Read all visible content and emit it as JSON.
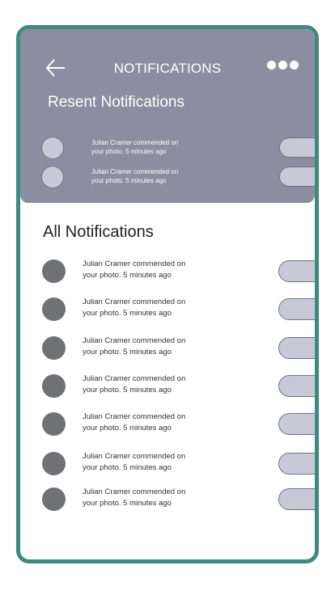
{
  "header": {
    "title": "NOTIFICATIONS",
    "back_icon": "arrow-left-icon",
    "more_icon": "more-horizontal-icon"
  },
  "recent": {
    "heading": "Resent Notifications",
    "items": [
      {
        "line1": "Julian Cramer commended on",
        "line2": "your photo. 5 minutes ago"
      },
      {
        "line1": "Julian Cramer commended on",
        "line2": "your photo. 5 minutes ago"
      }
    ]
  },
  "all": {
    "heading": "All Notifications",
    "items": [
      {
        "line1": "Julian Cramer commended on",
        "line2": "your photo. 5 minutes ago"
      },
      {
        "line1": "Julian Cramer commended on",
        "line2": "your photo. 5 minutes ago"
      },
      {
        "line1": "Julian Cramer commended on",
        "line2": "your photo. 5 minutes ago"
      },
      {
        "line1": "Julian Cramer commended on",
        "line2": "your photo. 5 minutes ago"
      },
      {
        "line1": "Julian Cramer commended on",
        "line2": "your photo. 5 minutes ago"
      },
      {
        "line1": "Julian Cramer commended on",
        "line2": "your photo. 5 minutes ago"
      },
      {
        "line1": "Julian Cramer commended on",
        "line2": "your photo. 5 minutes ago"
      }
    ]
  },
  "colors": {
    "frame": "#3f8a80",
    "header_bg": "#8b8ea0",
    "pill": "#c7cad6",
    "avatar": "#707174"
  }
}
